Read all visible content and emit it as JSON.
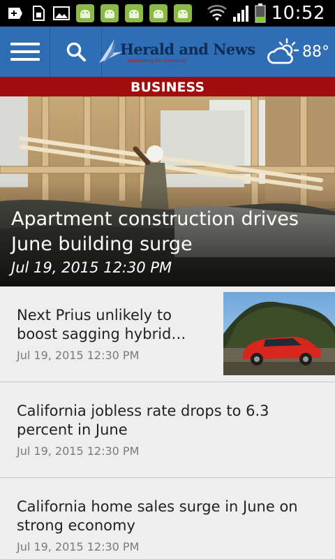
{
  "status_bar": {
    "time": "10:52",
    "left_icons": [
      "add-icon",
      "sim-card-icon",
      "gallery-icon",
      "android-icon",
      "android-icon",
      "android-icon",
      "android-icon",
      "android-icon"
    ],
    "right_icons": [
      "wifi-icon",
      "signal-icon",
      "battery-icon"
    ],
    "battery_level": 0.3
  },
  "header": {
    "logo_name": "Herald and News",
    "logo_tagline": "empowering the community",
    "temperature": "88°",
    "weather_icon": "partly-sunny-icon",
    "brand_color": "#2f6eb5"
  },
  "section": {
    "label": "BUSINESS",
    "color": "#a00d0d"
  },
  "hero": {
    "title": "Apartment construction drives June building surge",
    "date": "Jul 19, 2015 12:30 PM"
  },
  "articles": [
    {
      "title_line1": "Next Prius unlikely to",
      "title_line2": "boost sagging hybrid…",
      "date": "Jul 19, 2015 12:30 PM",
      "has_thumbnail": true
    },
    {
      "title_line1": "California jobless rate drops to 6.3",
      "title_line2": "percent in June",
      "date": "Jul 19, 2015 12:30 PM",
      "has_thumbnail": false
    },
    {
      "title_line1": "California home sales surge in June on",
      "title_line2": "strong economy",
      "date": "Jul 19, 2015 12:30 PM",
      "has_thumbnail": false
    }
  ]
}
